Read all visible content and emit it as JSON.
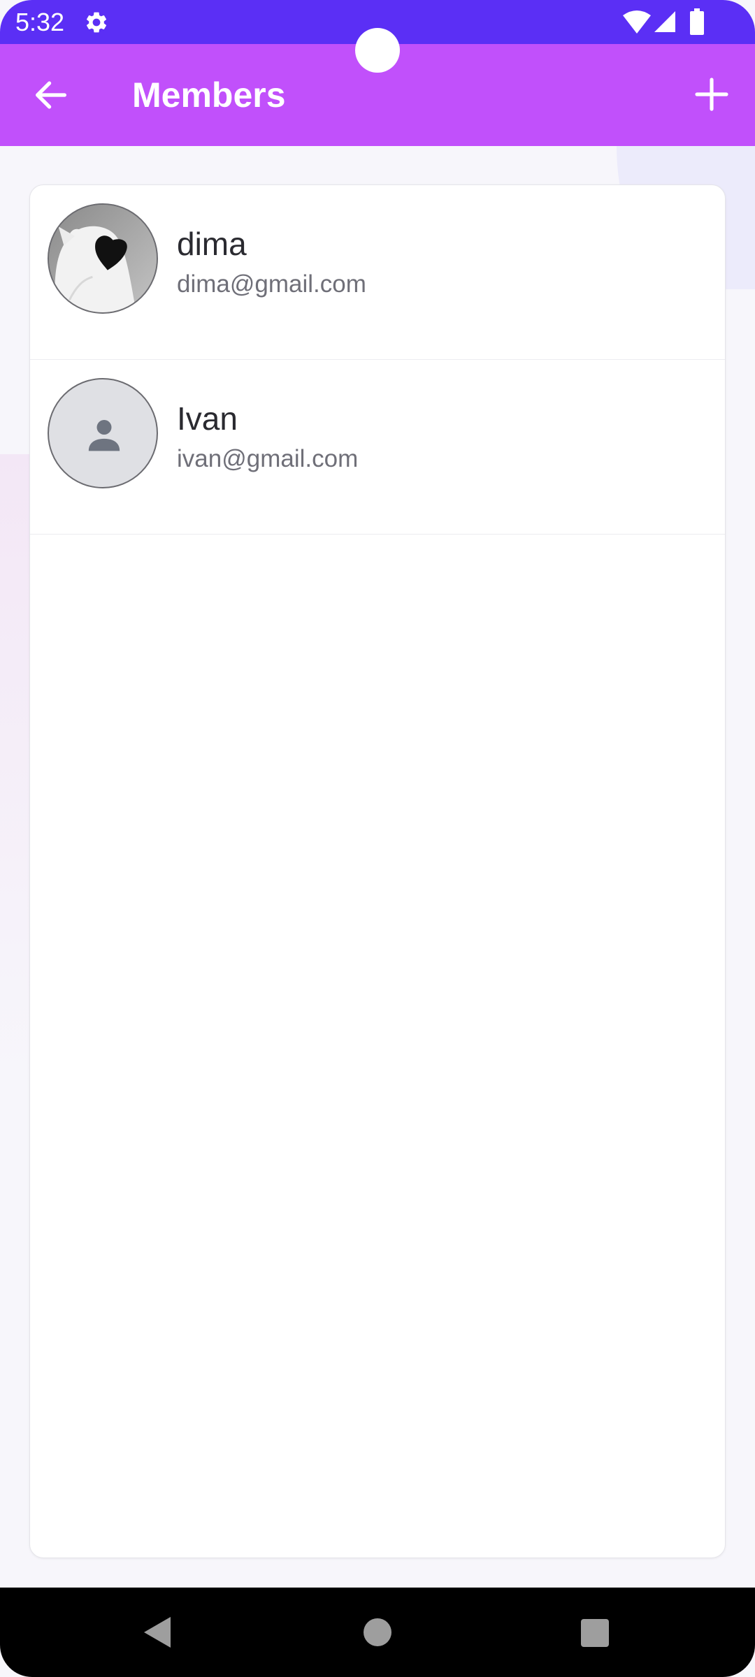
{
  "status_bar": {
    "time": "5:32",
    "icons": [
      "gear-icon",
      "wifi-icon",
      "signal-icon",
      "battery-icon"
    ],
    "color": "#5b2ff5"
  },
  "app_bar": {
    "title": "Members",
    "back_icon": "arrow-left-icon",
    "add_icon": "plus-icon",
    "color": "#c150fb"
  },
  "members": [
    {
      "name": "dima",
      "email": "dima@gmail.com",
      "avatar": "photo"
    },
    {
      "name": "Ivan",
      "email": "ivan@gmail.com",
      "avatar": "default-person-icon"
    }
  ],
  "nav_bar": {
    "icons": [
      "back-triangle-icon",
      "home-circle-icon",
      "recents-square-icon"
    ]
  }
}
